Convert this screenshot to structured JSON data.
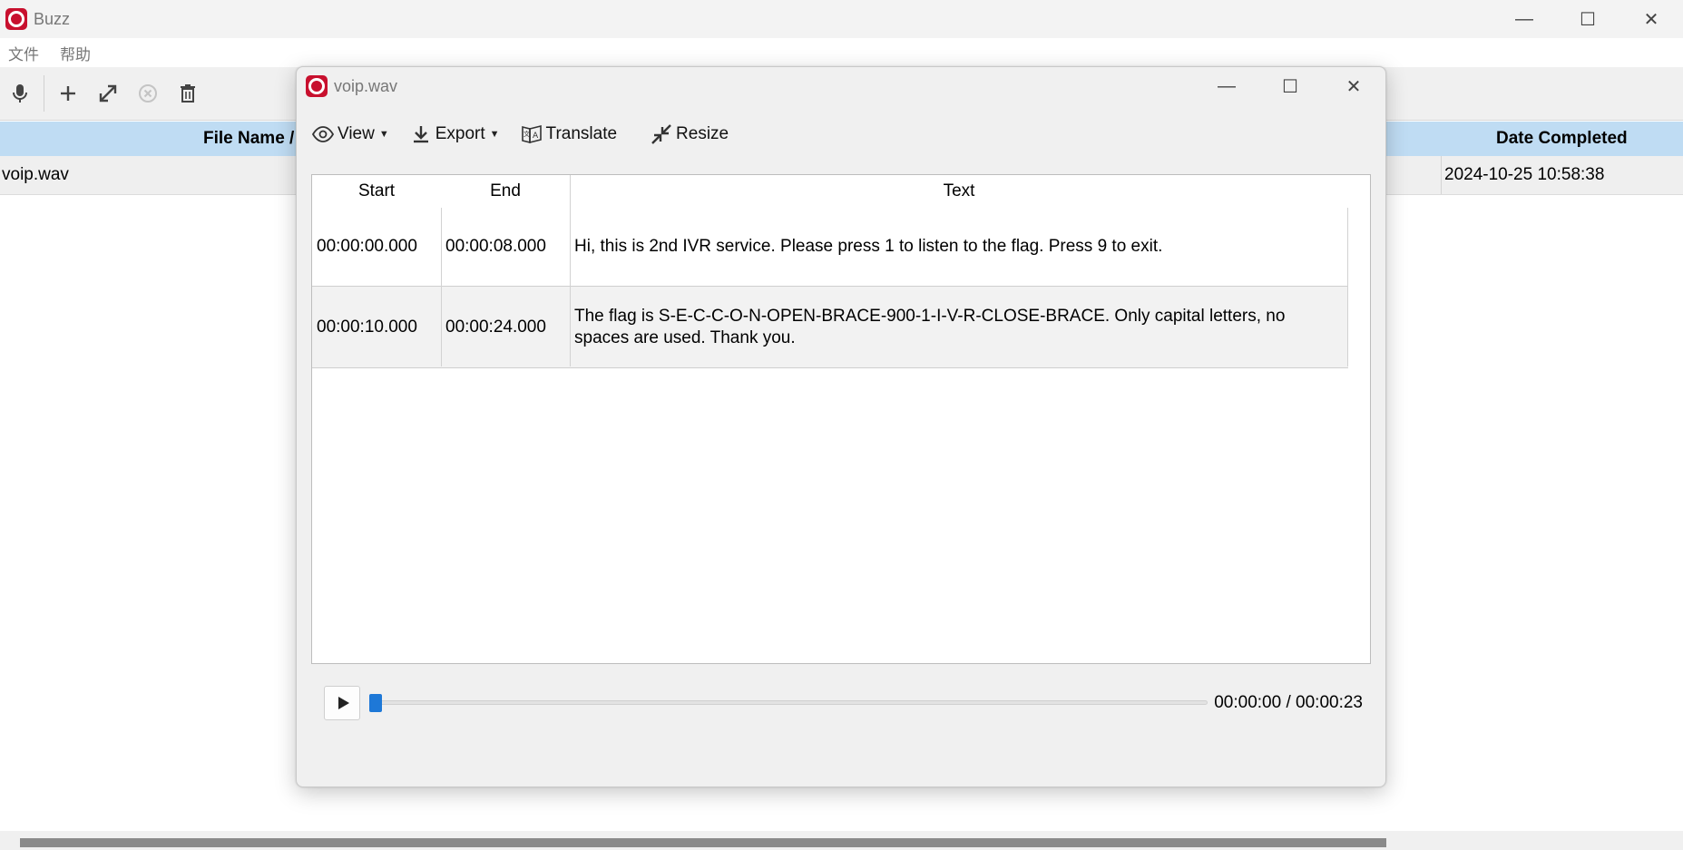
{
  "app": {
    "title": "Buzz"
  },
  "window_controls": {
    "minimize": "—",
    "maximize": "☐",
    "close": "✕"
  },
  "menu": [
    {
      "label": "文件"
    },
    {
      "label": "帮助"
    }
  ],
  "toolbar": {
    "icons": [
      "microphone-icon",
      "plus-icon",
      "expand-icon",
      "cancel-icon",
      "trash-icon"
    ]
  },
  "table": {
    "columns": {
      "file_name": "File Name /",
      "date_completed": "Date Completed"
    },
    "rows": [
      {
        "file_name": "voip.wav",
        "date_completed": "2024-10-25 10:58:38"
      }
    ]
  },
  "dialog": {
    "title": "voip.wav",
    "toolbar": {
      "view": "View",
      "export": "Export",
      "translate": "Translate",
      "resize": "Resize"
    },
    "headers": {
      "start": "Start",
      "end": "End",
      "text": "Text"
    },
    "segments": [
      {
        "start": "00:00:00.000",
        "end": "00:00:08.000",
        "text": "Hi, this is 2nd IVR service. Please press 1 to listen to the flag. Press 9 to exit."
      },
      {
        "start": "00:00:10.000",
        "end": "00:00:24.000",
        "text": "The flag is S-E-C-C-O-N-OPEN-BRACE-900-1-I-V-R-CLOSE-BRACE. Only capital letters, no spaces are used. Thank you."
      }
    ],
    "player": {
      "time": "00:00:00 / 00:00:23",
      "position": 0
    }
  },
  "colors": {
    "accent": "#1e78d7",
    "header_bg": "#bfdcf3",
    "logo": "#c8102e"
  }
}
